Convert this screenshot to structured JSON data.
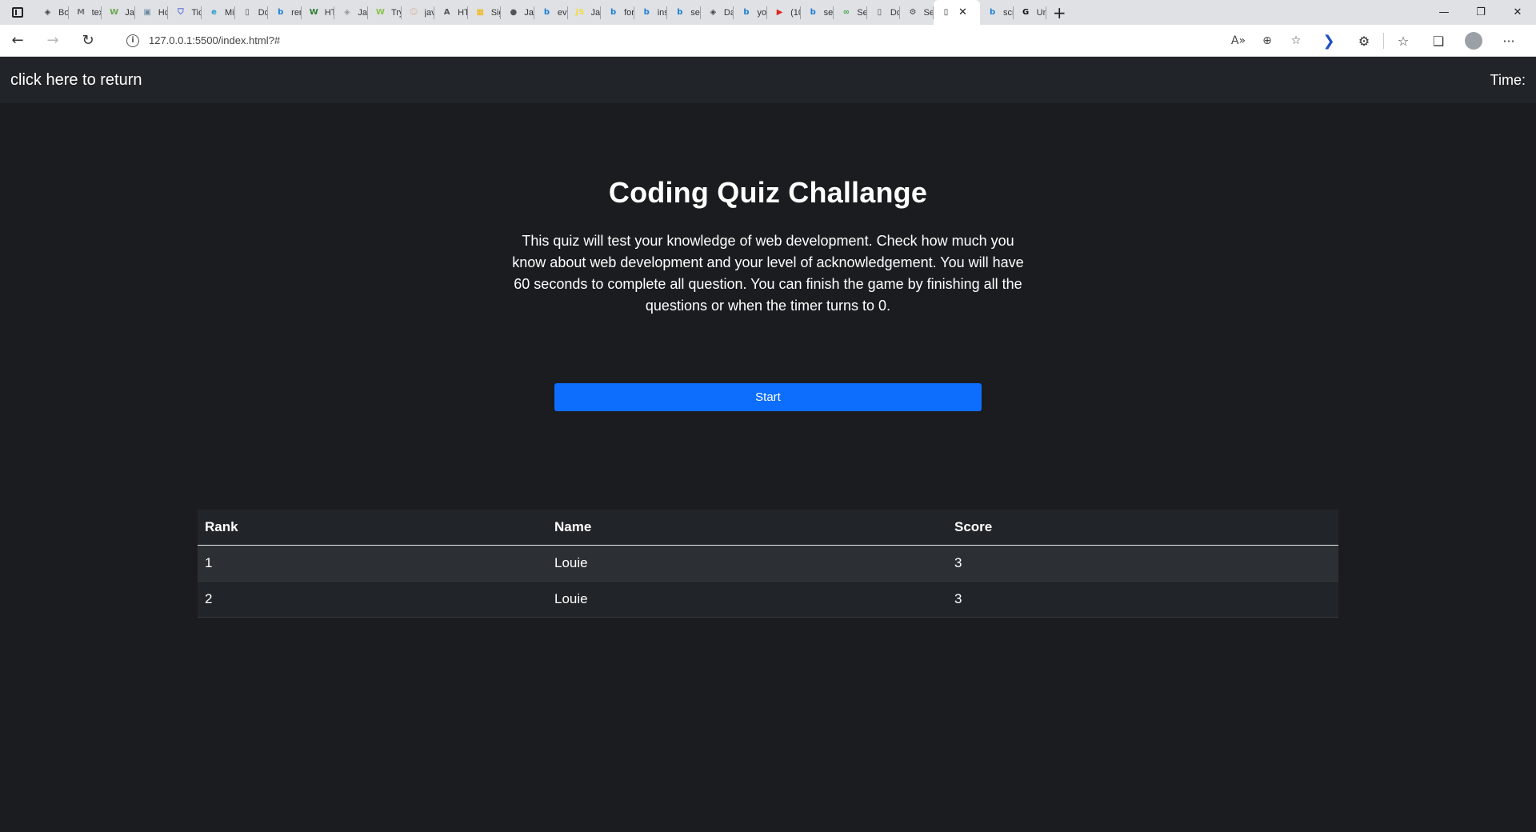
{
  "browser": {
    "tabs": [
      {
        "label": "Boo",
        "icon": "diamond-icon",
        "color": "#444"
      },
      {
        "label": "text",
        "icon": "m-icon",
        "color": "#777"
      },
      {
        "label": "Java",
        "icon": "w-icon",
        "color": "#6aa84f"
      },
      {
        "label": "Ho",
        "icon": "image-icon",
        "color": "#6b8ba4"
      },
      {
        "label": "Tick",
        "icon": "shield-icon",
        "color": "#5b6bd4"
      },
      {
        "label": "Mic",
        "icon": "edge-icon",
        "color": "#2e9bcc"
      },
      {
        "label": "Doc",
        "icon": "page-icon",
        "color": "#555"
      },
      {
        "label": "rem",
        "icon": "bing-icon",
        "color": "#1c7ed6"
      },
      {
        "label": "HTM",
        "icon": "w-icon",
        "color": "#2e7d32"
      },
      {
        "label": "Java",
        "icon": "diamond-icon",
        "color": "#999"
      },
      {
        "label": "Try",
        "icon": "w-icon",
        "color": "#8bc34a"
      },
      {
        "label": "java",
        "icon": "person-icon",
        "color": "#d7b899"
      },
      {
        "label": "HTM",
        "icon": "a-icon",
        "color": "#555"
      },
      {
        "label": "Sign",
        "icon": "grid-icon",
        "color": "#f4b400"
      },
      {
        "label": "Java",
        "icon": "circle-icon",
        "color": "#555"
      },
      {
        "label": "eve",
        "icon": "bing-icon",
        "color": "#1c7ed6"
      },
      {
        "label": "Java",
        "icon": "js-icon",
        "color": "#f0db4f"
      },
      {
        "label": "forn",
        "icon": "bing-icon",
        "color": "#1c7ed6"
      },
      {
        "label": "inse",
        "icon": "bing-icon",
        "color": "#1c7ed6"
      },
      {
        "label": "sele",
        "icon": "bing-icon",
        "color": "#1c7ed6"
      },
      {
        "label": "Dat",
        "icon": "diamond-icon",
        "color": "#444"
      },
      {
        "label": "yot",
        "icon": "bing-icon",
        "color": "#1c7ed6"
      },
      {
        "label": "(10",
        "icon": "youtube-icon",
        "color": "#e02424"
      },
      {
        "label": "sele",
        "icon": "bing-icon",
        "color": "#1c7ed6"
      },
      {
        "label": "Sel",
        "icon": "link-icon",
        "color": "#43a047"
      },
      {
        "label": "Doc",
        "icon": "page-icon",
        "color": "#555"
      },
      {
        "label": "Set",
        "icon": "gear-icon",
        "color": "#444"
      }
    ],
    "active_tab": {
      "label": "",
      "icon": "page-icon"
    },
    "after_tabs": [
      {
        "label": "scri",
        "icon": "bing-icon",
        "color": "#1c7ed6"
      },
      {
        "label": "Unt",
        "icon": "g-icon",
        "color": "#111"
      }
    ],
    "url": "127.0.0.1:5500/index.html?#"
  },
  "navbar": {
    "return_link": "click here to return",
    "time_label": "Time:"
  },
  "hero": {
    "title": "Coding Quiz Challange",
    "intro": "This quiz will test your knowledge of web development. Check how much you know about web development and your level of acknowledgement. You will have 60 seconds to complete all question. You can finish the game by finishing all the questions or when the timer turns to 0.",
    "start_label": "Start"
  },
  "scoreboard": {
    "columns": [
      "Rank",
      "Name",
      "Score"
    ],
    "rows": [
      [
        "1",
        "Louie",
        "3"
      ],
      [
        "2",
        "Louie",
        "3"
      ]
    ]
  },
  "colors": {
    "page_bg": "#1b1c1f",
    "navbar_bg": "#212529",
    "primary": "#0d6efd"
  }
}
